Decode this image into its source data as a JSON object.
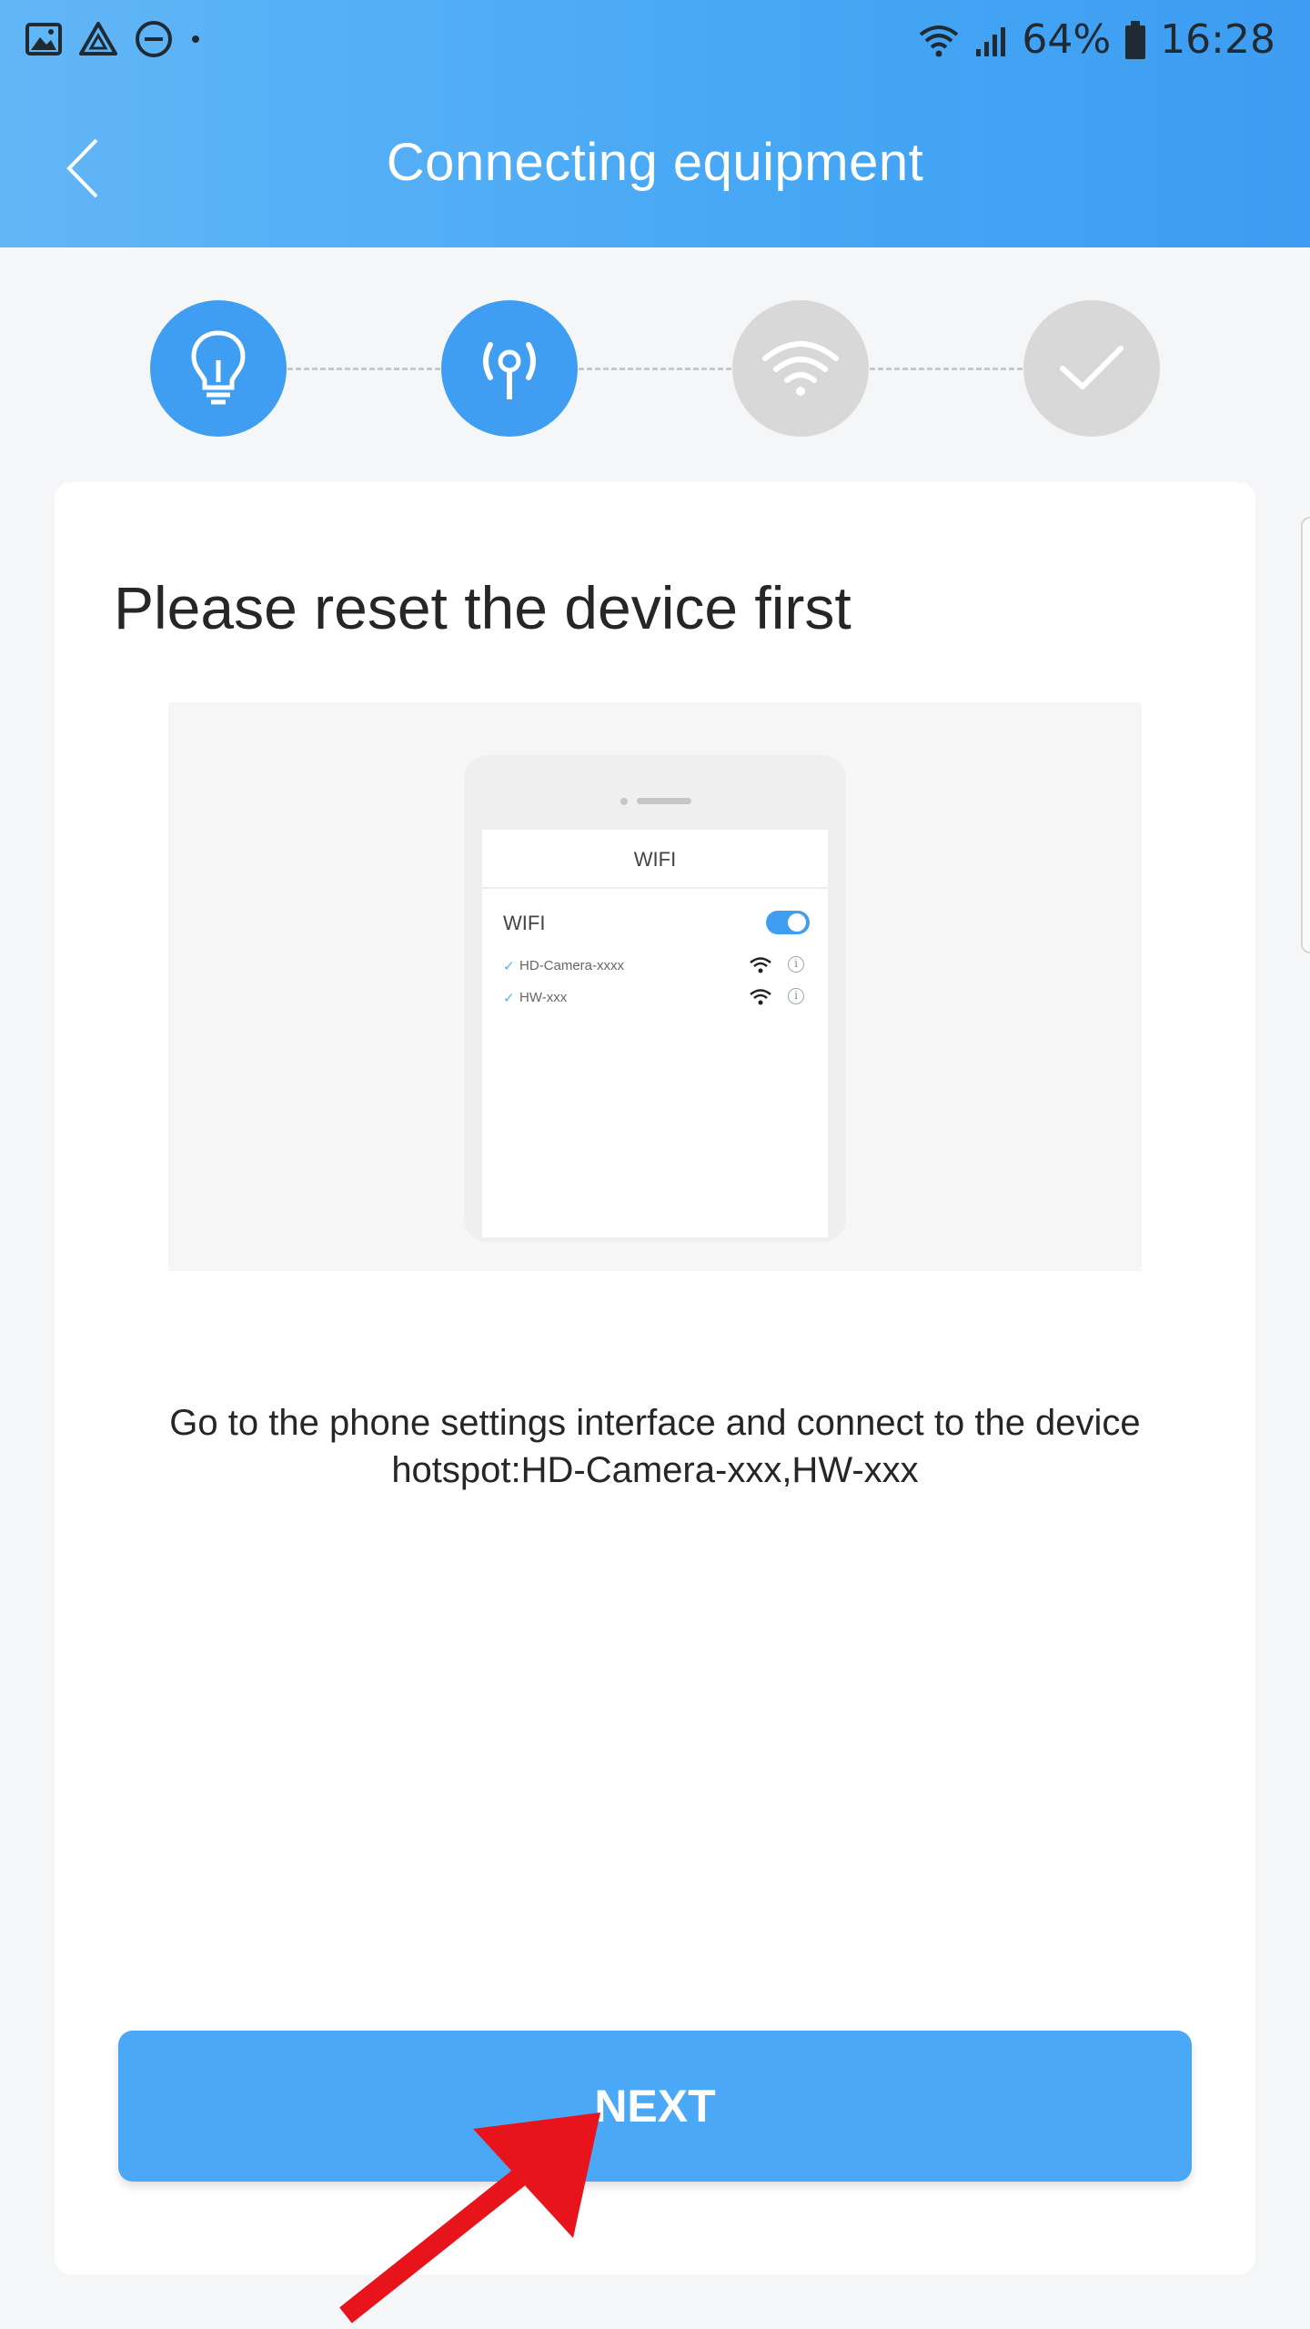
{
  "status_bar": {
    "battery": "64%",
    "time": "16:28",
    "icons": [
      "gallery-icon",
      "drive-icon",
      "do-not-disturb-icon",
      "wifi-icon",
      "signal-icon",
      "battery-icon"
    ]
  },
  "header": {
    "title": "Connecting equipment",
    "back_icon": "chevron-left-icon"
  },
  "steps": [
    {
      "icon": "lightbulb-icon",
      "state": "active"
    },
    {
      "icon": "hotspot-icon",
      "state": "active"
    },
    {
      "icon": "wifi-icon",
      "state": "inactive"
    },
    {
      "icon": "check-icon",
      "state": "inactive"
    }
  ],
  "main": {
    "heading": "Please reset the device first",
    "illustration": {
      "screen_title": "WIFI",
      "wifi_label": "WIFI",
      "networks": [
        {
          "name": "HD-Camera-xxxx"
        },
        {
          "name": "HW-xxx"
        }
      ]
    },
    "description_line1": "Go to the phone settings interface and connect to the device",
    "description_line2": "hotspot:HD-Camera-xxx,HW-xxx"
  },
  "footer": {
    "next_label": "NEXT"
  },
  "colors": {
    "accent": "#3f9ef1",
    "inactive": "#d8d8d8",
    "arrow": "#e8141b"
  }
}
